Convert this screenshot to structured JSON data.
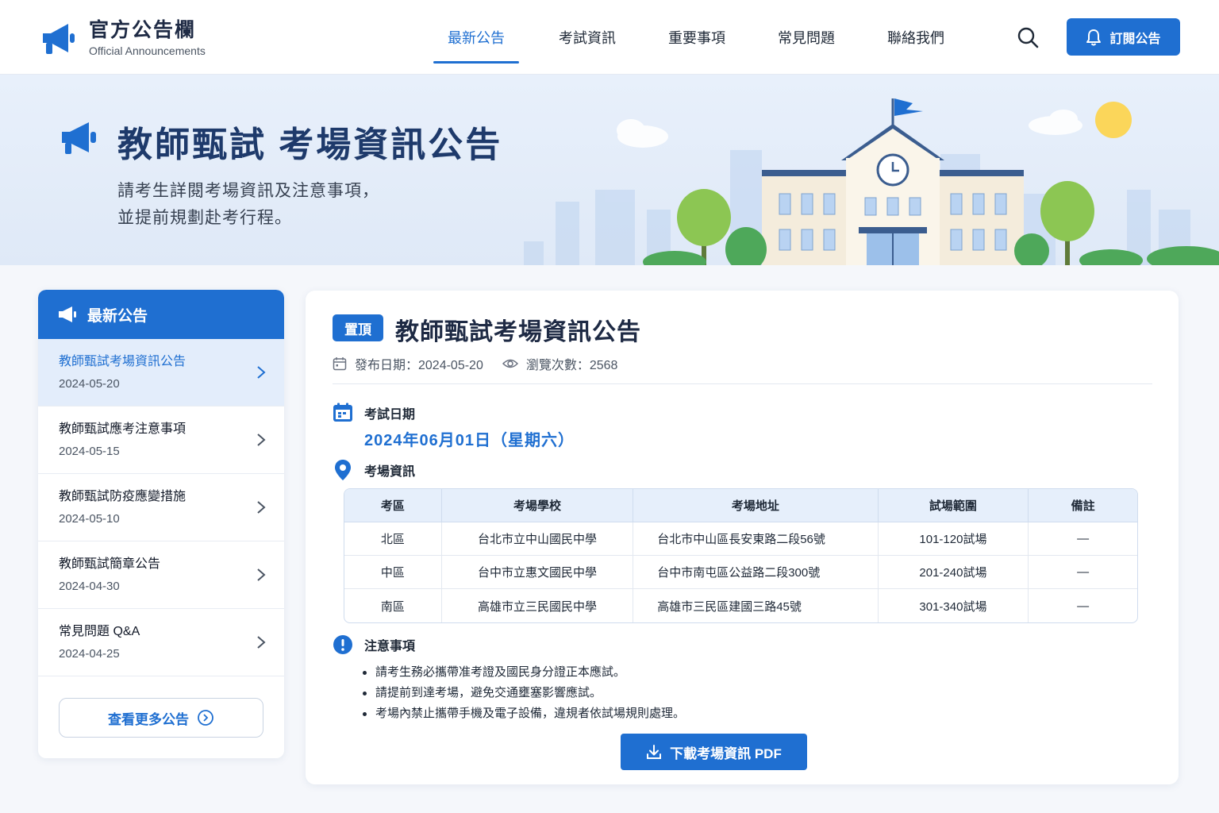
{
  "header": {
    "site_title": "官方公告欄",
    "site_subtitle": "Official Announcements",
    "nav": [
      {
        "label": "最新公告",
        "active": true
      },
      {
        "label": "考試資訊",
        "active": false
      },
      {
        "label": "重要事項",
        "active": false
      },
      {
        "label": "常見問題",
        "active": false
      },
      {
        "label": "聯絡我們",
        "active": false
      }
    ],
    "search_icon": "search-icon",
    "subscribe_label": "訂閱公告"
  },
  "banner": {
    "title": "教師甄試 考場資訊公告",
    "desc_line1": "請考生詳閱考場資訊及注意事項，",
    "desc_line2": "並提前規劃赴考行程。"
  },
  "sidebar": {
    "heading": "最新公告",
    "items": [
      {
        "title": "教師甄試考場資訊公告",
        "date": "2024-05-20",
        "active": true
      },
      {
        "title": "教師甄試應考注意事項",
        "date": "2024-05-15",
        "active": false
      },
      {
        "title": "教師甄試防疫應變措施",
        "date": "2024-05-10",
        "active": false
      },
      {
        "title": "教師甄試簡章公告",
        "date": "2024-04-30",
        "active": false
      },
      {
        "title": "常見問題 Q&A",
        "date": "2024-04-25",
        "active": false
      }
    ],
    "more_label": "查看更多公告"
  },
  "article": {
    "pin_label": "置頂",
    "title": "教師甄試考場資訊公告",
    "publish_date": "發布日期：2024-05-20",
    "views": "瀏覽次數：2568",
    "exam_date_heading": "考試日期",
    "exam_date": "2024年06月01日（星期六）",
    "venue_heading": "考場資訊",
    "table": {
      "headers": [
        "考區",
        "考場學校",
        "考場地址",
        "試場範圍",
        "備註"
      ],
      "rows": [
        [
          "北區",
          "台北市立中山國民中學",
          "台北市中山區長安東路二段56號",
          "101-120試場",
          "—"
        ],
        [
          "中區",
          "台中市立惠文國民中學",
          "台中市南屯區公益路二段300號",
          "201-240試場",
          "—"
        ],
        [
          "南區",
          "高雄市立三民國民中學",
          "高雄市三民區建國三路45號",
          "301-340試場",
          "—"
        ]
      ]
    },
    "notes_heading": "注意事項",
    "notes": [
      "請考生務必攜帶准考證及國民身分證正本應試。",
      "請提前到達考場，避免交通壅塞影響應試。",
      "考場內禁止攜帶手機及電子設備，違規者依試場規則處理。"
    ],
    "download_label": "下載考場資訊 PDF"
  },
  "colors": {
    "primary": "#1f6fd1",
    "heading": "#1e3a6b",
    "banner_bg": "#e8f0fb"
  }
}
